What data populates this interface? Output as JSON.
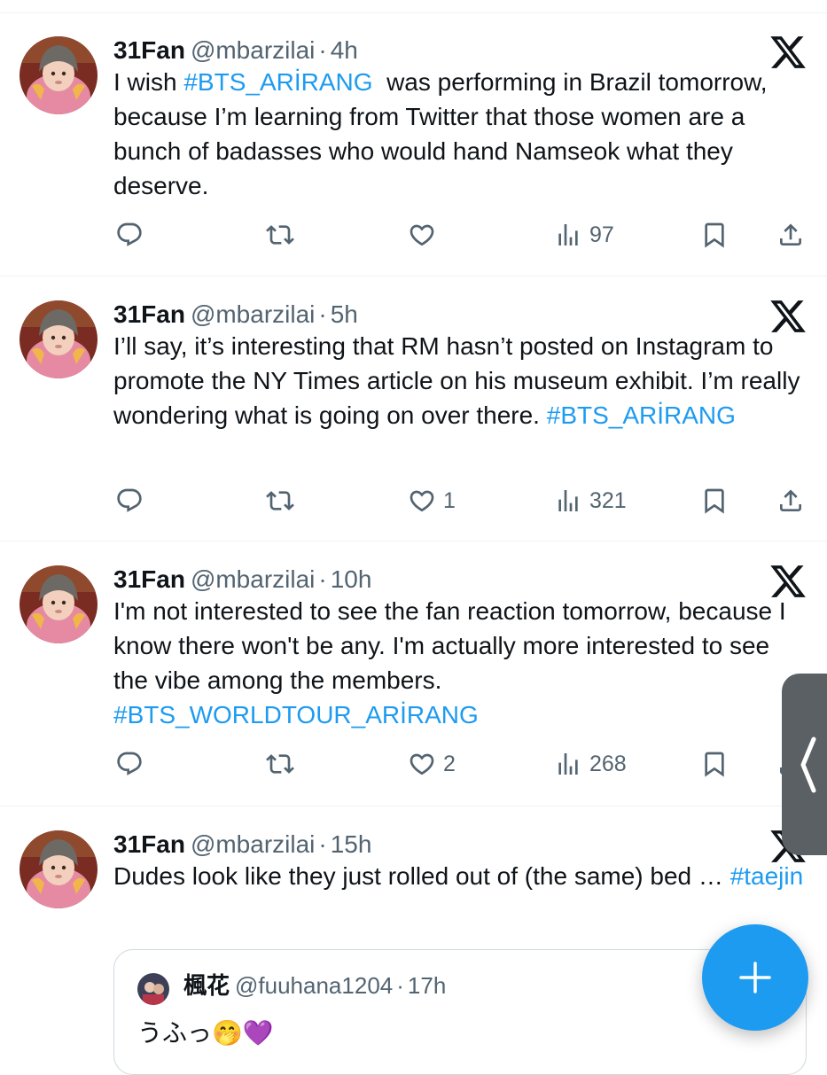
{
  "colors": {
    "accent": "#1d9bf0",
    "text": "#0f1419",
    "muted": "#536471",
    "divider": "#eff3f4"
  },
  "icons": {
    "close": "x-logo-icon",
    "reply": "reply-icon",
    "retweet": "retweet-icon",
    "like": "heart-icon",
    "views": "views-icon",
    "bookmark": "bookmark-icon",
    "share": "share-icon",
    "fab": "plus-icon",
    "side_tab": "chevron-left-icon"
  },
  "tweets": [
    {
      "name": "31Fan",
      "handle": "@mbarzilai",
      "dot": "·",
      "time": "4h",
      "text_before": "I wish ",
      "tag1": "#BTS_ARİRANG",
      "text_after": "  was performing in Brazil tomorrow, because I’m learning from Twitter that those women are a bunch of badasses who would hand Namseok what they deserve.",
      "likes": "",
      "views": "97"
    },
    {
      "name": "31Fan",
      "handle": "@mbarzilai",
      "dot": "·",
      "time": "5h",
      "text": "I’ll say, it’s interesting that RM hasn’t posted on Instagram to promote the NY Times article on his museum exhibit.  I’m really wondering what is going on over there. ",
      "tag1": "#BTS_ARİRANG",
      "likes": "1",
      "views": "321"
    },
    {
      "name": "31Fan",
      "handle": "@mbarzilai",
      "dot": "·",
      "time": "10h",
      "text": "I'm not interested to see the fan reaction tomorrow, because I know there won't be any.  I'm actually more interested to see the vibe among the members. ",
      "tag1": "#BTS_WORLDTOUR_ARİRANG",
      "likes": "2",
      "views": "268"
    },
    {
      "name": "31Fan",
      "handle": "@mbarzilai",
      "dot": "·",
      "time": "15h",
      "text": "Dudes look like they just rolled out of (the same) bed … ",
      "tag1": "#taejin",
      "quote": {
        "name": "楓花",
        "handle": "@fuuhana1204",
        "dot": "·",
        "time": "17h",
        "text": "うふっ🤭💜"
      }
    }
  ]
}
